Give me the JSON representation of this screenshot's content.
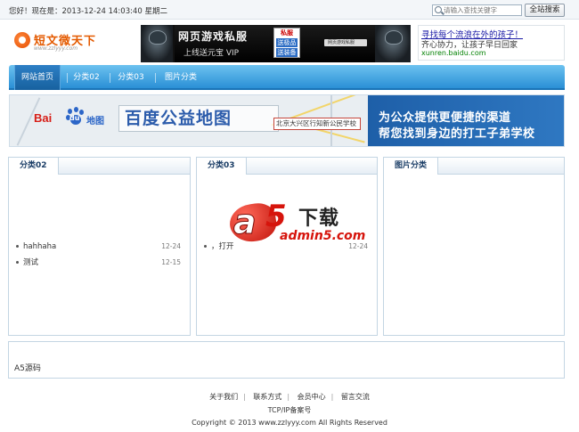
{
  "topbar": {
    "greeting": "您好！现在是：2013-12-24 14:03:40 星期二",
    "search_placeholder": "请输入查找关键字",
    "search_button": "全站搜索"
  },
  "logo": {
    "name": "短文微天下",
    "url": "www.zzlyyy.com"
  },
  "banner_ad": {
    "title": "网页游戏私服",
    "subtitle": "上线送元宝 VIP",
    "badge_line1": "私服",
    "badge_line2": "送极品",
    "badge_line3": "送装备",
    "tag": "网页游戏私服"
  },
  "text_ad": {
    "title": "寻找每个流浪在外的孩子！",
    "desc": "齐心协力，让孩子早日回家",
    "url": "xunren.baidu.com"
  },
  "nav": {
    "items": [
      {
        "label": "网站首页"
      },
      {
        "label": "分类02"
      },
      {
        "label": "分类03"
      },
      {
        "label": "图片分类"
      }
    ]
  },
  "map_banner": {
    "brand": "Bai",
    "brand_du": "du",
    "brand_suffix": "地图",
    "title": "百度公益地图",
    "bubble": "北京大兴区行知新公民学校",
    "line1": "为公众提供更便捷的渠道",
    "line2": "帮您找到身边的打工子弟学校"
  },
  "panels": [
    {
      "title": "分类02",
      "rows": [
        {
          "text": "hahhaha",
          "date": "12-24"
        },
        {
          "text": "测试",
          "date": "12-15"
        }
      ]
    },
    {
      "title": "分类03",
      "logo_text": {
        "letter": "a",
        "five": "5",
        "download": "下载",
        "domain": "admin5.com"
      },
      "rows": [
        {
          "text": "，打开",
          "date": "12-24"
        }
      ]
    },
    {
      "title": "图片分类",
      "rows": []
    }
  ],
  "bottom_box": {
    "text": "A5源码"
  },
  "footer": {
    "links": [
      "关于我们",
      "联系方式",
      "会员中心",
      "留言交流"
    ],
    "icp": "TCP/IP备案号",
    "copyright": "Copyright © 2013 www.zzlyyy.com All Rights Reserved"
  }
}
